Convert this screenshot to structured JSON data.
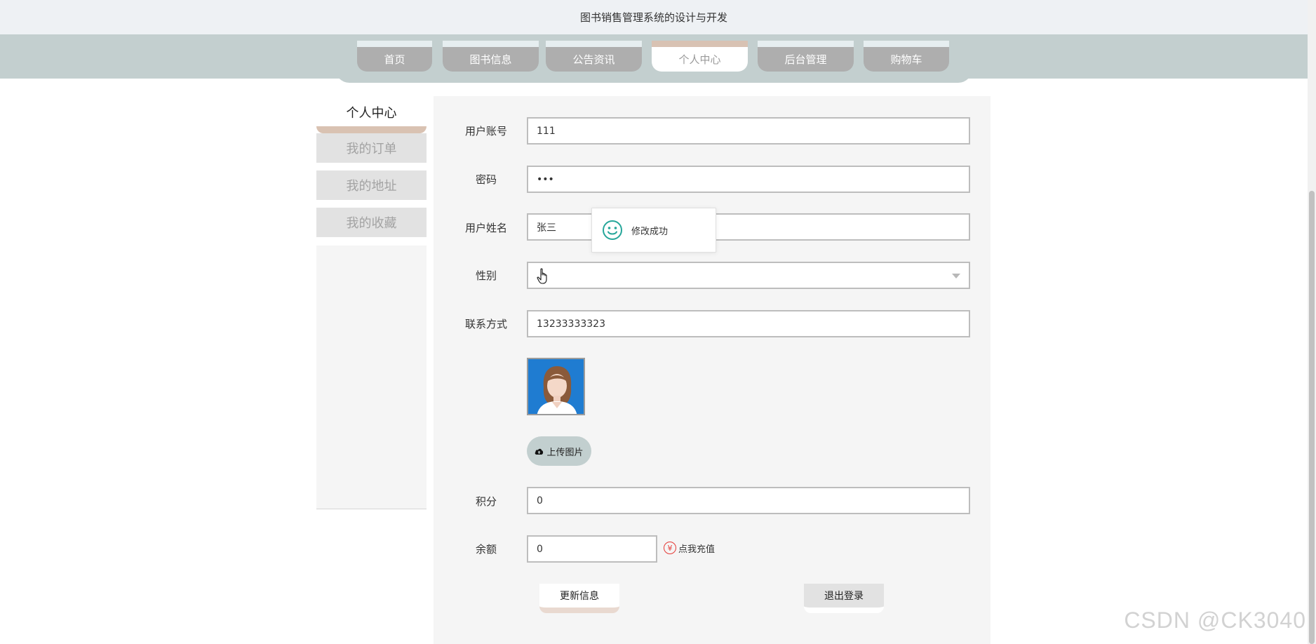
{
  "app": {
    "title": "图书销售管理系统的设计与开发"
  },
  "nav": {
    "tabs": [
      {
        "label": "首页"
      },
      {
        "label": "图书信息"
      },
      {
        "label": "公告资讯"
      },
      {
        "label": "个人中心"
      },
      {
        "label": "后台管理"
      },
      {
        "label": "购物车"
      }
    ],
    "active": "个人中心"
  },
  "sidebar": {
    "title": "个人中心",
    "items": [
      {
        "label": "我的订单"
      },
      {
        "label": "我的地址"
      },
      {
        "label": "我的收藏"
      }
    ]
  },
  "form": {
    "account": {
      "label": "用户账号",
      "value": "111"
    },
    "password": {
      "label": "密码",
      "value": "•••"
    },
    "name": {
      "label": "用户姓名",
      "value": "张三"
    },
    "gender": {
      "label": "性别",
      "value": ""
    },
    "phone": {
      "label": "联系方式",
      "value": "13233333323"
    },
    "upload_label": "上传图片",
    "points": {
      "label": "积分",
      "value": "0"
    },
    "balance": {
      "label": "余额",
      "value": "0"
    },
    "recharge_label": "点我充值",
    "update_label": "更新信息",
    "logout_label": "退出登录"
  },
  "toast": {
    "message": "修改成功"
  },
  "watermark": "CSDN @CK3040",
  "colors": {
    "nav_band": "#c3cfcf",
    "tab_inactive": "#aeaeae",
    "accent_tan": "#d9c2b2",
    "toast_icon": "#26a69a",
    "recharge_icon": "#e53935"
  }
}
